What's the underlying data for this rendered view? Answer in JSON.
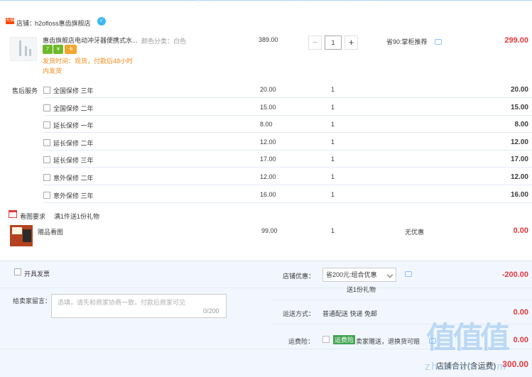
{
  "shop": {
    "tag": "天猫",
    "label": "店铺：",
    "name": "h2ofloss惠齿旗舰店",
    "ww_icon": "ww-chat-icon"
  },
  "item": {
    "title": "惠齿旗舰店电动冲牙器便携式水...",
    "sku": "颜色分类：白色",
    "badges": [
      {
        "text": "7",
        "color": "#6eb92b"
      },
      {
        "text": "¥",
        "color": "#6eb92b"
      },
      {
        "text": "卡",
        "color": "#f0a52d"
      }
    ],
    "ship_line1": "发货时间：现货，付款后48小时",
    "ship_line2": "内发货",
    "unit_price": "389.00",
    "qty": "1",
    "qty_minus": "−",
    "qty_plus": "+",
    "promo": "省90:掌柜推荐",
    "subtotal": "299.00"
  },
  "services": {
    "title": "售后服务",
    "items": [
      {
        "name": "全国保修 三年",
        "price": "20.00",
        "qty": "1",
        "total": "20.00"
      },
      {
        "name": "全国保修 二年",
        "price": "15.00",
        "qty": "1",
        "total": "15.00"
      },
      {
        "name": "延长保修 一年",
        "price": "8.00",
        "qty": "1",
        "total": "8.00"
      },
      {
        "name": "延长保修 二年",
        "price": "12.00",
        "qty": "1",
        "total": "12.00"
      },
      {
        "name": "延长保修 三年",
        "price": "17.00",
        "qty": "1",
        "total": "17.00"
      },
      {
        "name": "意外保修 二年",
        "price": "12.00",
        "qty": "1",
        "total": "12.00"
      },
      {
        "name": "意外保修 三年",
        "price": "16.00",
        "qty": "1",
        "total": "16.00"
      }
    ]
  },
  "gift": {
    "label": "看图要求",
    "rule": "满1件送1份礼物",
    "name": "赠品看图",
    "price": "99.00",
    "qty": "1",
    "discount": "无优惠",
    "total": "0.00"
  },
  "footer": {
    "invoice": "开具发票",
    "message_label": "给卖家留言：",
    "message_placeholder": "选填，请先和商家协商一致，付款后商家可见",
    "message_count": "0/200",
    "coupon_label": "店铺优惠：",
    "coupon_value": "省200元:组合优惠",
    "coupon_gift": "送1份礼物",
    "coupon_amount": "-200.00",
    "delivery_label": "运送方式：",
    "delivery_value": "普通配送 快递 免邮",
    "delivery_amount": "0.00",
    "insurance_label": "运费险：",
    "insurance_tag": "运费险",
    "insurance_text": "卖家赠送，退换货可赔",
    "insurance_amount": "0.00",
    "total_label": "店铺合计(含运费)",
    "total_amount": "300.00"
  },
  "watermark": {
    "text": "值值值",
    "sub": "zhizhizhi.com"
  },
  "colors": {
    "accent_red": "#e4393c",
    "ship_orange": "#f08a1c",
    "panel_bg": "#f2f7ff",
    "insurance_green": "#3fa451"
  }
}
